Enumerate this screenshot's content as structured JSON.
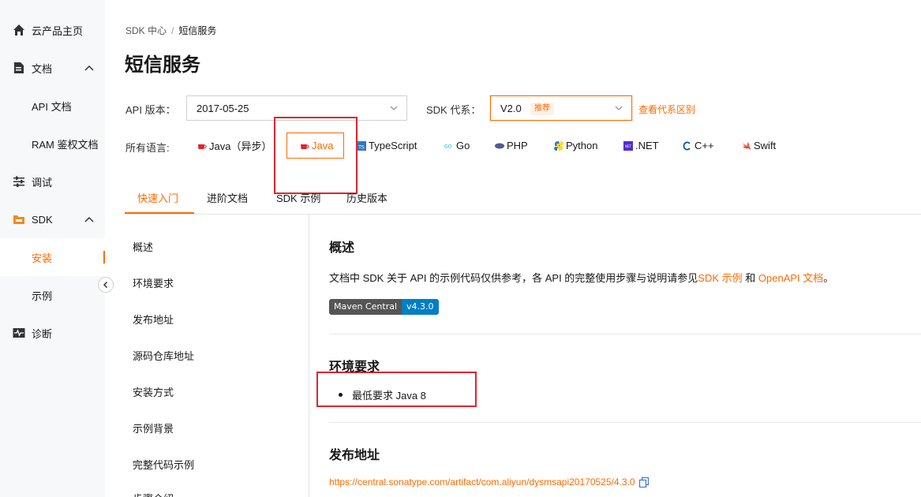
{
  "sidebar": {
    "items": [
      {
        "label": "云产品主页",
        "icon": "home-icon"
      },
      {
        "label": "文档",
        "icon": "document-icon"
      },
      {
        "label": "API 文档"
      },
      {
        "label": "RAM 鉴权文档"
      },
      {
        "label": "调试",
        "icon": "sliders-icon"
      },
      {
        "label": "SDK",
        "icon": "sdk-folder-icon"
      },
      {
        "label": "安装"
      },
      {
        "label": "示例"
      },
      {
        "label": "诊断",
        "icon": "pulse-icon"
      }
    ]
  },
  "breadcrumb": {
    "root": "SDK 中心",
    "sep": "/",
    "current": "短信服务"
  },
  "page": {
    "title": "短信服务"
  },
  "filters": {
    "api_label": "API 版本：",
    "api_value": "2017-05-25",
    "sdk_label": "SDK 代系：",
    "sdk_value": "V2.0",
    "sdk_badge": "推荐",
    "diff_link": "查看代系区别"
  },
  "languages": {
    "label": "所有语言:",
    "items": [
      "Java（异步）",
      "Java",
      "TypeScript",
      "Go",
      "PHP",
      "Python",
      ".NET",
      "C++",
      "Swift"
    ],
    "selected": "Java"
  },
  "tabs": [
    "快速入门",
    "进阶文档",
    "SDK 示例",
    "历史版本"
  ],
  "toc": [
    "概述",
    "环境要求",
    "发布地址",
    "源码仓库地址",
    "安装方式",
    "示例背景",
    "完整代码示例",
    "步骤介绍"
  ],
  "content": {
    "overview_title": "概述",
    "overview_text_1": "文档中 SDK 关于 API 的示例代码仅供参考，各 API 的完整使用步骤与说明请参见",
    "overview_link_1": "SDK 示例",
    "overview_text_2": " 和 ",
    "overview_link_2": "OpenAPI 文档",
    "overview_text_3": "。",
    "shield_left": "Maven Central",
    "shield_right": "v4.3.0",
    "env_title": "环境要求",
    "env_item": "最低要求 Java 8",
    "release_title": "发布地址",
    "release_url": "https://central.sonatype.com/artifact/com.aliyun/dysmsapi20170525/4.3.0"
  },
  "colors": {
    "accent": "#ff6a00",
    "highlight_box": "#e0242f"
  }
}
